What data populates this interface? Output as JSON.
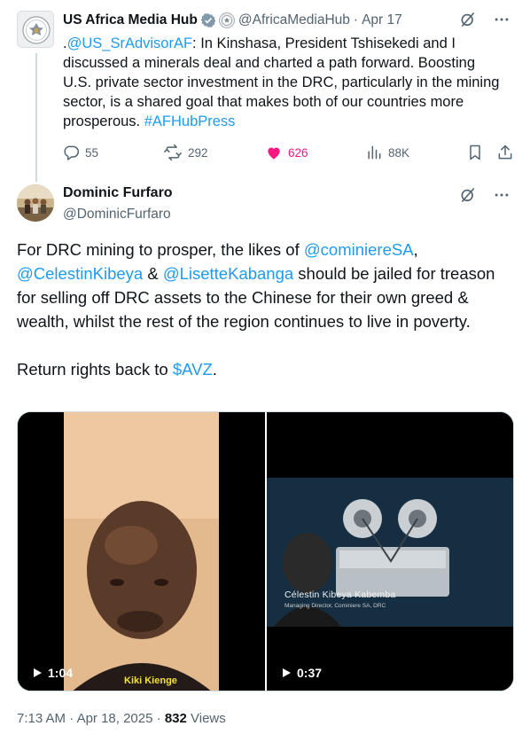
{
  "parent": {
    "name": "US Africa Media Hub",
    "handle": "@AfricaMediaHub",
    "sep": "·",
    "date": "Apr 17",
    "text_prefix": ".",
    "mention": "@US_SrAdvisorAF",
    "text_body": ": In Kinshasa, President Tshisekedi and I discussed a minerals deal and charted a path forward.  Boosting U.S. private sector investment in the DRC, particularly in the mining sector, is a shared goal that makes both of our countries more prosperous. ",
    "hashtag": "#AFHubPress",
    "stats": {
      "replies": "55",
      "reposts": "292",
      "likes": "626",
      "views": "88K"
    }
  },
  "reply": {
    "name": "Dominic Furfaro",
    "handle": "@DominicFurfaro",
    "p1": {
      "t1": "For DRC mining to prosper, the likes of ",
      "m1": "@cominiereSA",
      "t2": ",",
      "m2": "@CelestinKibeya",
      "t3": " & ",
      "m3": "@LisetteKabanga",
      "t4": " should be jailed for treason for selling off DRC assets to the Chinese for their own greed & wealth, whilst the rest of the region continues to live in poverty."
    },
    "p2": {
      "t1": "Return rights back to ",
      "cashtag": "$AVZ",
      "t2": "."
    },
    "media": [
      {
        "duration": "1:04",
        "caption": "Kiki Kienge"
      },
      {
        "duration": "0:37",
        "caption": "Célestin Kibeya Kabemba",
        "subcaption": "Managing Director, Cominiere SA, DRC"
      }
    ],
    "time": "7:13 AM",
    "sep": "·",
    "date": "Apr 18, 2025",
    "views_count": "832",
    "views_label": "Views"
  },
  "colors": {
    "accent": "#1d9bf0",
    "like": "#f91880",
    "muted": "#536471",
    "text": "#0f1419"
  },
  "icons": [
    "grok-icon",
    "more-icon",
    "reply-icon",
    "repost-icon",
    "like-icon-filled",
    "views-icon",
    "bookmark-icon",
    "share-icon",
    "play-icon",
    "gov-badge-icon"
  ]
}
